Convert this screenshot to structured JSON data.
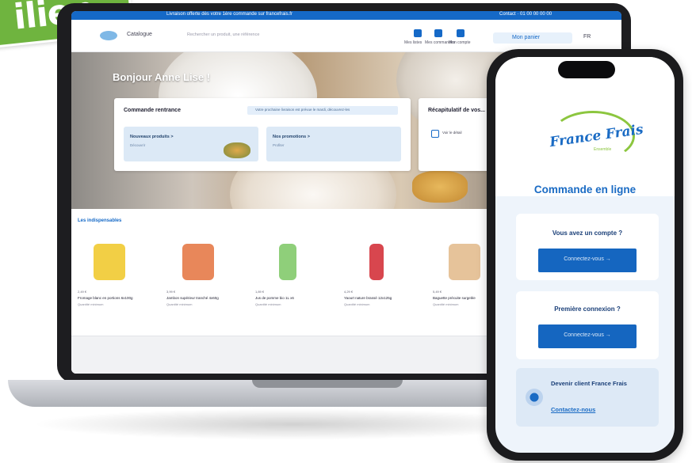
{
  "badge": {
    "text": "ilien"
  },
  "laptop": {
    "topstrip": {
      "left_text": "Livraison offerte dès votre 1ère commande sur francefrais.fr",
      "right_text": "Contact · 01 00 00 00 00"
    },
    "navbar": {
      "nav_label": "Catalogue",
      "search_placeholder": "Rechercher un produit, une référence",
      "icons": [
        {
          "name": "list-icon",
          "label": "Mes listes"
        },
        {
          "name": "order-icon",
          "label": "Mes commandes"
        },
        {
          "name": "account-icon",
          "label": "Mon compte"
        }
      ],
      "cart_label": "Mon panier",
      "lang": "FR"
    },
    "greeting": "Bonjour Anne Lise !",
    "commande_card": {
      "title": "Commande rentrance",
      "info": "Votre prochaine livraison est prévue le mardi, découvrez-les",
      "tiles": [
        {
          "title": "Nouveaux produits >",
          "sub": "Découvrir"
        },
        {
          "title": "Nos promotions >",
          "sub": "Profiter"
        }
      ]
    },
    "side_card": {
      "title": "Récapitulatif de vos...",
      "item": "Voir le détail"
    },
    "products": {
      "heading": "Les indispensables",
      "items": [
        {
          "price": "2,49 €",
          "name": "Fromage blanc en portions 6x100g",
          "qty": "Quantité minimum",
          "color": "#f2cf45"
        },
        {
          "price": "3,99 €",
          "name": "Jambon supérieur tranché 4x60g",
          "qty": "Quantité minimum",
          "color": "#e8875a"
        },
        {
          "price": "1,89 €",
          "name": "Jus de pomme bio 1L x6",
          "qty": "Quantité minimum",
          "color": "#8fcf7a"
        },
        {
          "price": "4,29 €",
          "name": "Yaourt nature brassé 12x125g",
          "qty": "Quantité minimum",
          "color": "#d8464e"
        },
        {
          "price": "5,49 €",
          "name": "Baguette précuite surgelée",
          "qty": "Quantité minimum",
          "color": "#e6c39a"
        }
      ]
    }
  },
  "phone": {
    "logo_text": "France Frais",
    "logo_sub": "Ensemble",
    "title": "Commande en ligne",
    "account_q": "Vous avez un compte ?",
    "account_btn": "Connectez-vous →",
    "first_q": "Première connexion ?",
    "first_btn": "Connectez-vous →",
    "client_title": "Devenir client France Frais",
    "client_link": "Contactez-nous"
  }
}
